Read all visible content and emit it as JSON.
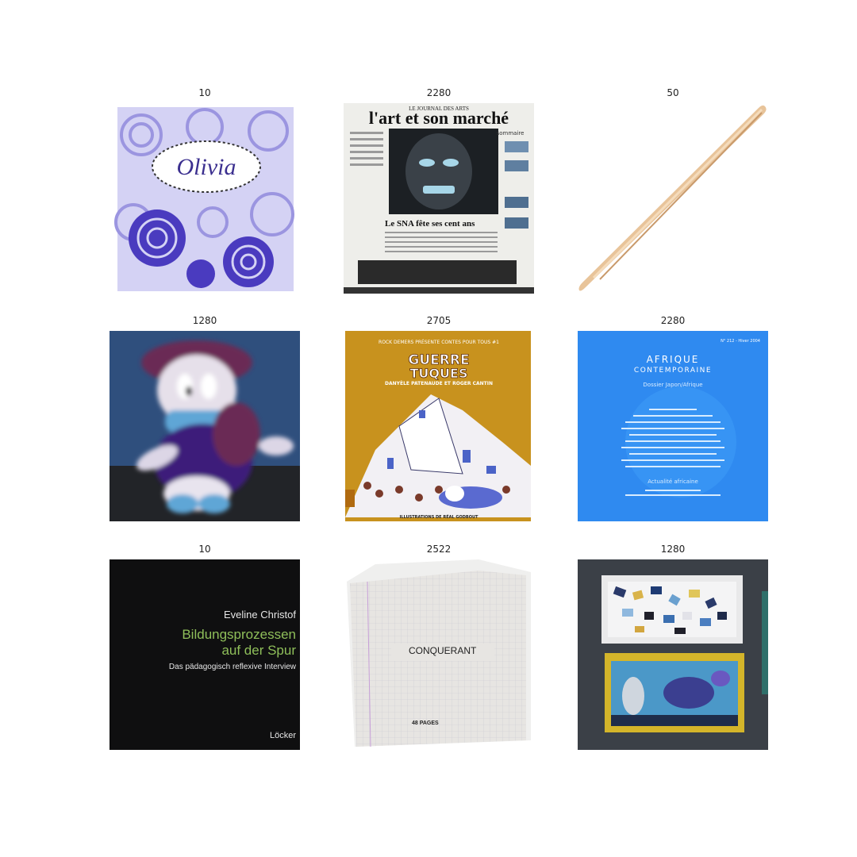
{
  "grid": {
    "cells": [
      {
        "label": "10",
        "image": "olivia-floral-notebook",
        "cover_text": "Olivia"
      },
      {
        "label": "2280",
        "image": "newspaper-front-page",
        "cover_text": {
          "masthead_small": "LE JOURNAL DES ARTS",
          "masthead": "l'art et son marché",
          "headline": "Le SNA fête ses cent ans",
          "sidebar": "sommaire"
        }
      },
      {
        "label": "50",
        "image": "wooden-stylus"
      },
      {
        "label": "1280",
        "image": "plush-duck-toy"
      },
      {
        "label": "2705",
        "image": "comic-book-cover",
        "cover_text": {
          "top": "ROCK DEMERS PRÉSENTE CONTES POUR TOUS #1",
          "title_line1": "GUERRE",
          "title_line2": "TUQUES",
          "authors": "DANYÈLE PATENAUDE ET ROGER CANTIN",
          "bottom": "ILLUSTRATIONS DE RÉAL GODBOUT"
        }
      },
      {
        "label": "2280",
        "image": "journal-cover-blue",
        "cover_text": {
          "issue": "N° 212 - Hiver 2004",
          "title1": "AFRIQUE",
          "title2": "CONTEMPORAINE",
          "subtitle": "Dossier Japon/Afrique",
          "section": "Actualité africaine"
        }
      },
      {
        "label": "10",
        "image": "book-cover-black",
        "cover_text": {
          "author": "Eveline Christof",
          "title1": "Bildungsprozessen",
          "title2": "auf der Spur",
          "subtitle": "Das pädagogisch reflexive Interview",
          "publisher": "Löcker"
        }
      },
      {
        "label": "2522",
        "image": "grid-notebook",
        "cover_text": {
          "brand": "CONQUERANT",
          "pages": "48 PAGES"
        }
      },
      {
        "label": "1280",
        "image": "jigsaw-puzzle-box"
      }
    ]
  }
}
